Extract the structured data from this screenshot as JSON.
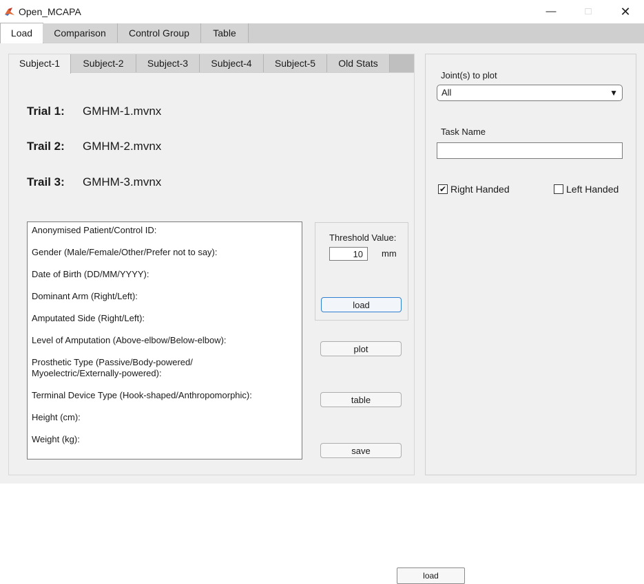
{
  "window": {
    "title": "Open_MCAPA",
    "minimize": "—",
    "maximize": "□",
    "close": "✕"
  },
  "main_tabs": [
    "Load",
    "Comparison",
    "Control Group",
    "Table"
  ],
  "subject_tabs": [
    "Subject-1",
    "Subject-2",
    "Subject-3",
    "Subject-4",
    "Subject-5",
    "Old Stats"
  ],
  "trials": [
    {
      "label": "Trial 1:",
      "file": "GMHM-1.mvnx"
    },
    {
      "label": "Trail 2:",
      "file": "GMHM-2.mvnx"
    },
    {
      "label": "Trail 3:",
      "file": "GMHM-3.mvnx"
    }
  ],
  "patient_info": [
    "Anonymised Patient/Control ID:",
    "Gender (Male/Female/Other/Prefer not to say):",
    "Date of Birth (DD/MM/YYYY):",
    "Dominant Arm (Right/Left):",
    "Amputated Side (Right/Left):",
    "Level of Amputation (Above-elbow/Below-elbow):",
    "Prosthetic Type (Passive/Body-powered/",
    "Myoelectric/Externally-powered):",
    "Terminal Device Type (Hook-shaped/Anthropomorphic):",
    "Height (cm):",
    "Weight (kg):"
  ],
  "threshold": {
    "label": "Threshold Value:",
    "value": "10",
    "unit": "mm"
  },
  "buttons": {
    "load": "load",
    "plot": "plot",
    "table": "table",
    "save": "save",
    "bottom_load": "load"
  },
  "right_panel": {
    "joints_label": "Joint(s) to plot",
    "joints_selected": "All",
    "task_name_label": "Task Name",
    "task_name_value": "",
    "right_handed_label": "Right Handed",
    "right_handed_checked": true,
    "left_handed_label": "Left Handed",
    "left_handed_checked": false
  },
  "colors": {
    "accent": "#2f7fd1",
    "panel_bg": "#f0f0f0",
    "tab_bg": "#d4d4d4"
  }
}
